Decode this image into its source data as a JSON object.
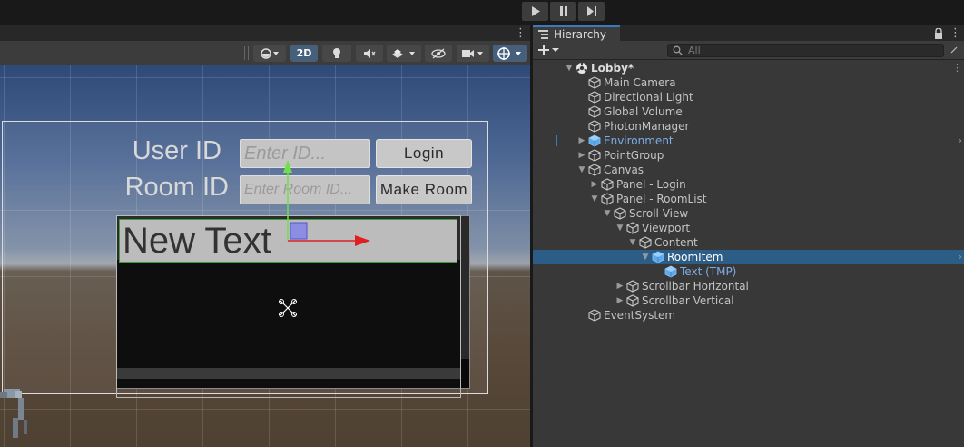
{
  "playbar": {
    "buttons": [
      "play-icon",
      "pause-icon",
      "step-icon"
    ]
  },
  "scene_toolbar": {
    "mode_2d_label": "2D",
    "icons": [
      "shading-mode-icon",
      "mode-2d",
      "lighting-icon",
      "audio-mute-icon",
      "effects-icon",
      "visibility-icon",
      "camera-icon",
      "gizmos-icon"
    ]
  },
  "scene": {
    "user_id_label": "User ID",
    "room_id_label": "Room ID",
    "user_id_placeholder": "Enter ID...",
    "room_id_placeholder": "Enter Room ID...",
    "login_label": "Login",
    "make_room_label": "Make Room",
    "room_item_text": "New Text"
  },
  "hierarchy": {
    "tab_label": "Hierarchy",
    "search_placeholder": "All",
    "items": [
      {
        "label": "Lobby*",
        "depth": 0,
        "expanded": true,
        "kind": "scene"
      },
      {
        "label": "Main Camera",
        "depth": 1,
        "kind": "object"
      },
      {
        "label": "Directional Light",
        "depth": 1,
        "kind": "object"
      },
      {
        "label": "Global Volume",
        "depth": 1,
        "kind": "object"
      },
      {
        "label": "PhotonManager",
        "depth": 1,
        "kind": "object"
      },
      {
        "label": "Environment",
        "depth": 1,
        "expanded": false,
        "kind": "prefab"
      },
      {
        "label": "PointGroup",
        "depth": 1,
        "expanded": false,
        "kind": "object"
      },
      {
        "label": "Canvas",
        "depth": 1,
        "expanded": true,
        "kind": "object"
      },
      {
        "label": "Panel - Login",
        "depth": 2,
        "expanded": false,
        "kind": "object"
      },
      {
        "label": "Panel - RoomList",
        "depth": 2,
        "expanded": true,
        "kind": "object"
      },
      {
        "label": "Scroll View",
        "depth": 3,
        "expanded": true,
        "kind": "object"
      },
      {
        "label": "Viewport",
        "depth": 4,
        "expanded": true,
        "kind": "object"
      },
      {
        "label": "Content",
        "depth": 5,
        "expanded": true,
        "kind": "object"
      },
      {
        "label": "RoomItem",
        "depth": 6,
        "expanded": true,
        "kind": "prefab",
        "selected": true
      },
      {
        "label": "Text (TMP)",
        "depth": 7,
        "kind": "prefab"
      },
      {
        "label": "Scrollbar Horizontal",
        "depth": 4,
        "expanded": false,
        "kind": "object"
      },
      {
        "label": "Scrollbar Vertical",
        "depth": 4,
        "expanded": false,
        "kind": "object"
      },
      {
        "label": "EventSystem",
        "depth": 1,
        "kind": "object"
      }
    ]
  },
  "colors": {
    "selection": "#2c5d87",
    "prefab_text": "#7bade6",
    "tab_accent": "#3a79bb"
  }
}
